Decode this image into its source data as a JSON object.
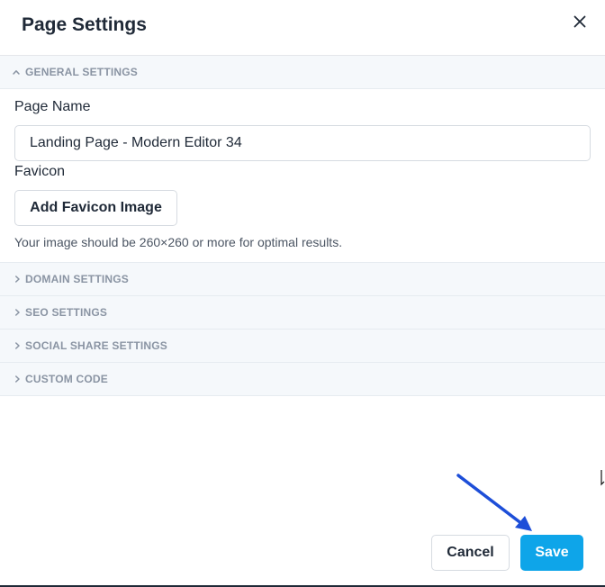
{
  "dialog": {
    "title": "Page Settings",
    "close_icon": "close-icon"
  },
  "sections": {
    "general": {
      "label": "GENERAL SETTINGS",
      "expanded": true
    },
    "domain": {
      "label": "DOMAIN SETTINGS",
      "expanded": false
    },
    "seo": {
      "label": "SEO SETTINGS",
      "expanded": false
    },
    "social": {
      "label": "SOCIAL SHARE SETTINGS",
      "expanded": false
    },
    "custom_code": {
      "label": "CUSTOM CODE",
      "expanded": false
    }
  },
  "general": {
    "page_name_label": "Page Name",
    "page_name_value": "Landing Page - Modern Editor 34",
    "favicon_label": "Favicon",
    "favicon_button": "Add Favicon Image",
    "favicon_hint": "Your image should be 260×260 or more for optimal results."
  },
  "footer": {
    "cancel_label": "Cancel",
    "save_label": "Save"
  },
  "colors": {
    "primary": "#0ea5e9",
    "annotation_arrow": "#1d4ed8",
    "section_bg": "#f5f8fb",
    "section_text": "#8a94a3"
  }
}
